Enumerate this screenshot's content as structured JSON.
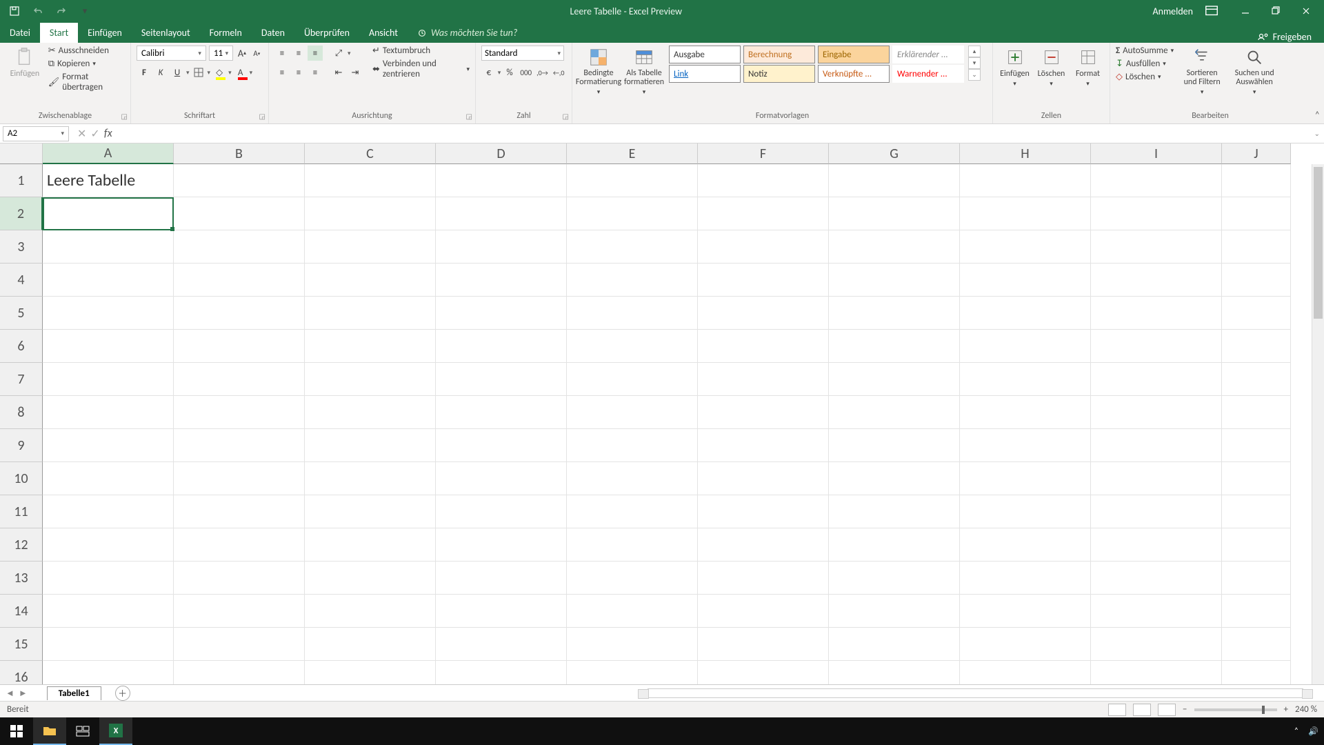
{
  "title": "Leere Tabelle  -  Excel Preview",
  "account": {
    "signin": "Anmelden"
  },
  "tabs": {
    "file": "Datei",
    "items": [
      "Start",
      "Einfügen",
      "Seitenlayout",
      "Formeln",
      "Daten",
      "Überprüfen",
      "Ansicht"
    ],
    "active_index": 0,
    "tellme": "Was möchten Sie tun?"
  },
  "share_label": "Freigeben",
  "ribbon": {
    "clipboard": {
      "label": "Zwischenablage",
      "paste": "Einfügen",
      "cut": "Ausschneiden",
      "copy": "Kopieren",
      "format_painter": "Format übertragen"
    },
    "font": {
      "label": "Schriftart",
      "name": "Calibri",
      "size": "11"
    },
    "alignment": {
      "label": "Ausrichtung",
      "wrap": "Textumbruch",
      "merge": "Verbinden und zentrieren"
    },
    "number": {
      "label": "Zahl",
      "format": "Standard"
    },
    "styles": {
      "label": "Formatvorlagen",
      "cond": "Bedingte Formatierung",
      "table": "Als Tabelle formatieren",
      "cells": [
        {
          "t": "Ausgabe",
          "bg": "#fff",
          "fg": "#333",
          "bd": "#888"
        },
        {
          "t": "Berechnung",
          "bg": "#fdeada",
          "fg": "#bf6f1f",
          "bd": "#888"
        },
        {
          "t": "Eingabe",
          "bg": "#fbd49c",
          "fg": "#9c6500",
          "bd": "#888"
        },
        {
          "t": "Erklärender ...",
          "bg": "#fff",
          "fg": "#888",
          "it": true,
          "bd": "transparent"
        },
        {
          "t": "Link",
          "bg": "#fff",
          "fg": "#0563c1",
          "ul": true,
          "bd": "#888"
        },
        {
          "t": "Notiz",
          "bg": "#fff2cc",
          "fg": "#333",
          "bd": "#888"
        },
        {
          "t": "Verknüpfte ...",
          "bg": "#fff",
          "fg": "#c65911",
          "bd": "#888"
        },
        {
          "t": "Warnender ...",
          "bg": "#fff",
          "fg": "#ff0000",
          "bd": "transparent"
        }
      ]
    },
    "cells": {
      "label": "Zellen",
      "insert": "Einfügen",
      "delete": "Löschen",
      "format": "Format"
    },
    "editing": {
      "label": "Bearbeiten",
      "sum": "AutoSumme",
      "fill": "Ausfüllen",
      "clear": "Löschen",
      "sort": "Sortieren und Filtern",
      "find": "Suchen und Auswählen"
    }
  },
  "formula_bar": {
    "namebox": "A2",
    "formula": ""
  },
  "grid": {
    "columns": [
      "A",
      "B",
      "C",
      "D",
      "E",
      "F",
      "G",
      "H",
      "I",
      "J"
    ],
    "rows": 16,
    "selected": "A2",
    "cells": {
      "A1": "Leere Tabelle"
    }
  },
  "sheets": {
    "active": "Tabelle1"
  },
  "status": {
    "ready": "Bereit",
    "zoom": "240 %"
  }
}
